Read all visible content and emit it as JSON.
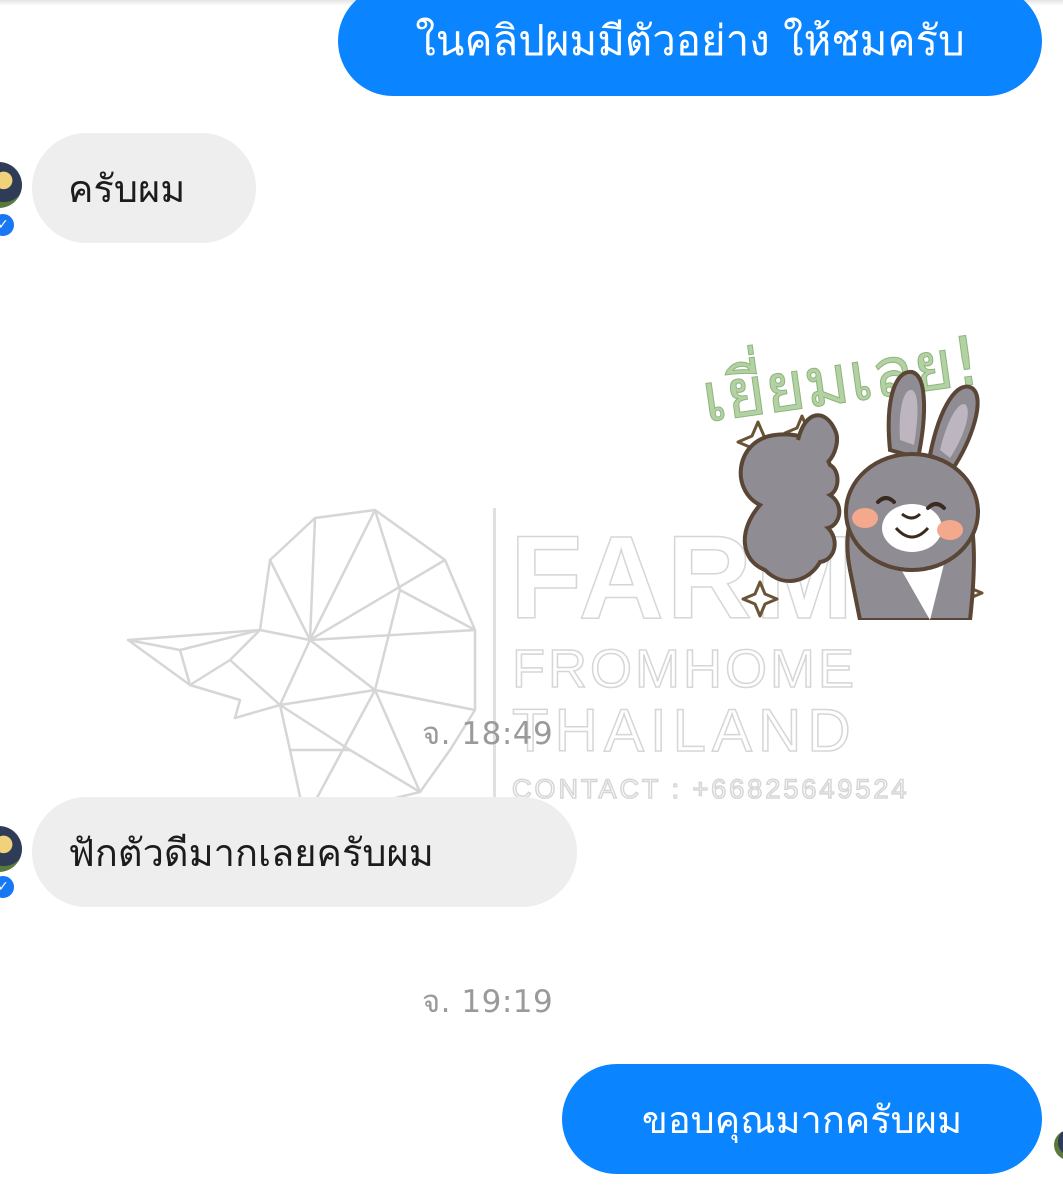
{
  "messages": [
    {
      "id": "m1",
      "direction": "outgoing",
      "text": "ในคลิปผมมีตัวอย่าง ให้ชมครับ"
    },
    {
      "id": "m2",
      "direction": "incoming",
      "text": "ครับผม"
    },
    {
      "id": "m3",
      "direction": "outgoing",
      "type": "sticker",
      "sticker_text": "เยี่ยมเลย!"
    },
    {
      "id": "m4",
      "direction": "incoming",
      "text": "ฟักตัวดีมากเลยครับผม"
    },
    {
      "id": "m5",
      "direction": "outgoing",
      "text": "ขอบคุณมากครับผม"
    }
  ],
  "timestamps": {
    "t1": "จ. 18:49",
    "t2": "จ. 19:19"
  },
  "watermark": {
    "line1": "FARM",
    "line2": "FROMHOME",
    "line3": "THAILAND",
    "line4": "CONTACT : +66825649524"
  },
  "colors": {
    "outgoing_bubble": "#0a84ff",
    "incoming_bubble": "#eeeeee",
    "sticker_text": "#a8c89a",
    "bunny": "#8f8c93"
  },
  "icons": {
    "verified": "messenger-verified-icon",
    "avatar": "contact-avatar"
  }
}
